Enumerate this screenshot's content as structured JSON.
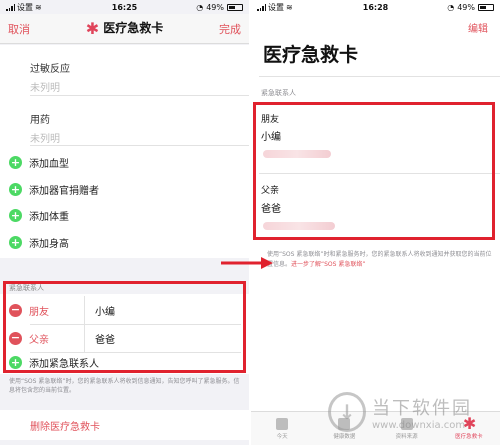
{
  "left": {
    "status": {
      "carrier": "设置",
      "time": "16:25",
      "battery": "49%"
    },
    "nav": {
      "cancel": "取消",
      "title": "医疗急救卡",
      "done": "完成"
    },
    "fields": [
      {
        "label": "过敏反应",
        "placeholder": "未列明"
      },
      {
        "label": "用药",
        "placeholder": "未列明"
      }
    ],
    "add_items": [
      "添加血型",
      "添加器官捐赠者",
      "添加体重",
      "添加身高"
    ],
    "contacts_header": "紧急联系人",
    "contacts": [
      {
        "relation": "朋友",
        "name": "小编"
      },
      {
        "relation": "父亲",
        "name": "爸爸"
      }
    ],
    "add_contact": "添加紧急联系人",
    "footnote": "使用“SOS 紧急联络”时，您的紧急联系人将收到信息通知，告知您呼叫了紧急服务。信息将包含您的当前位置。",
    "delete": "删除医疗急救卡"
  },
  "right": {
    "status": {
      "carrier": "设置",
      "time": "16:28",
      "battery": "49%"
    },
    "nav": {
      "edit": "编辑"
    },
    "title": "医疗急救卡",
    "section": "紧急联系人",
    "contacts": [
      {
        "relation": "朋友",
        "name": "小编"
      },
      {
        "relation": "父亲",
        "name": "爸爸"
      }
    ],
    "note_text": "使用“SOS 紧急联络”时和紧急服务时，您的紧急联系人将收到通知并获取您的当前位置信息。",
    "note_link": "进一步了解“SOS 紧急联络”",
    "tabs": [
      "今天",
      "健康数据",
      "资料来源",
      "医疗急救卡"
    ]
  },
  "watermark": {
    "brand": "当下软件园",
    "url": "www.downxia.com"
  },
  "colors": {
    "accent": "#e0525b",
    "highlight": "#e0222e",
    "add_green": "#4cd964"
  }
}
